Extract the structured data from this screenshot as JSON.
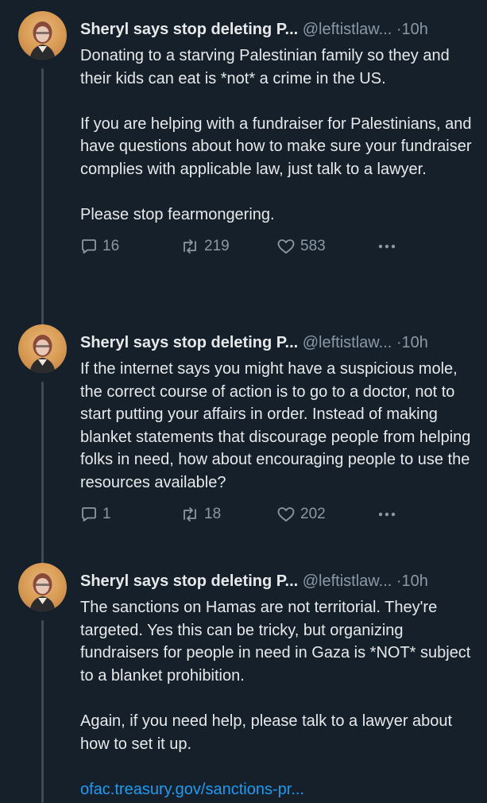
{
  "tweets": [
    {
      "author": "Sheryl says stop deleting P...",
      "handle": "@leftistlaw...",
      "separator": "·",
      "time": "10h",
      "paragraphs": [
        "Donating to a starving Palestinian family so they and their kids can eat is *not* a crime in the US.",
        "If you are helping with a fundraiser for Palestinians, and have questions about how to make sure your fundraiser complies with applicable law, just talk to a lawyer.",
        "Please stop fearmongering."
      ],
      "replies": "16",
      "retweets": "219",
      "likes": "583"
    },
    {
      "author": "Sheryl says stop deleting P...",
      "handle": "@leftistlaw...",
      "separator": "·",
      "time": "10h",
      "paragraphs": [
        "If the internet says you might have a suspicious mole, the correct course of action is to go to a doctor, not to start putting your affairs in order. Instead of making blanket statements that discourage people from helping folks in need, how about encouraging people to use the resources available?"
      ],
      "replies": "1",
      "retweets": "18",
      "likes": "202"
    },
    {
      "author": "Sheryl says stop deleting P...",
      "handle": "@leftistlaw...",
      "separator": "·",
      "time": "10h",
      "paragraphs": [
        "The sanctions on Hamas are not territorial. They're targeted. Yes this can be tricky, but organizing fundraisers for people in need in Gaza is *NOT* subject to a blanket prohibition.",
        "Again, if you need help, please talk to a lawyer about how to set it up."
      ],
      "link": "ofac.treasury.gov/sanctions-pr..."
    }
  ],
  "icons": {
    "reply": "reply-icon",
    "retweet": "retweet-icon",
    "like": "heart-icon",
    "more": "more-icon"
  },
  "colors": {
    "background": "#15202b",
    "text": "#e7e9ea",
    "secondary": "#8b98a5",
    "link": "#1d9bf0",
    "thread_line": "#3f4a55"
  }
}
